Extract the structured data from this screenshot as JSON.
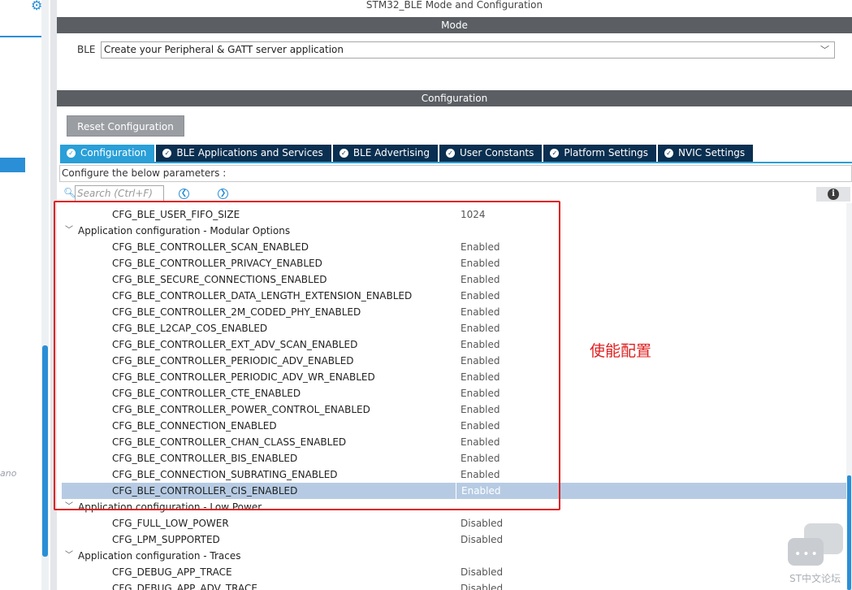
{
  "window_title": "STM32_BLE Mode and Configuration",
  "left_panel": {
    "ghost_text": "ano"
  },
  "mode_bar": {
    "label": "Mode"
  },
  "ble": {
    "label": "BLE",
    "selected": "Create your Peripheral & GATT server application"
  },
  "config_bar": {
    "label": "Configuration"
  },
  "reset_button": {
    "label": "Reset Configuration"
  },
  "tabs": [
    {
      "label": "Configuration",
      "active": true
    },
    {
      "label": "BLE Applications and Services",
      "active": false
    },
    {
      "label": "BLE Advertising",
      "active": false
    },
    {
      "label": "User Constants",
      "active": false
    },
    {
      "label": "Platform Settings",
      "active": false
    },
    {
      "label": "NVIC Settings",
      "active": false
    }
  ],
  "param_header": "Configure the below parameters :",
  "search": {
    "placeholder": "Search (Ctrl+F)"
  },
  "tree": [
    {
      "kind": "param",
      "name": "CFG_BLE_USER_FIFO_SIZE",
      "value": "1024"
    },
    {
      "kind": "group",
      "name": "Application configuration -  Modular Options"
    },
    {
      "kind": "param",
      "name": "CFG_BLE_CONTROLLER_SCAN_ENABLED",
      "value": "Enabled"
    },
    {
      "kind": "param",
      "name": "CFG_BLE_CONTROLLER_PRIVACY_ENABLED",
      "value": "Enabled"
    },
    {
      "kind": "param",
      "name": "CFG_BLE_SECURE_CONNECTIONS_ENABLED",
      "value": "Enabled"
    },
    {
      "kind": "param",
      "name": "CFG_BLE_CONTROLLER_DATA_LENGTH_EXTENSION_ENABLED",
      "value": "Enabled"
    },
    {
      "kind": "param",
      "name": "CFG_BLE_CONTROLLER_2M_CODED_PHY_ENABLED",
      "value": "Enabled"
    },
    {
      "kind": "param",
      "name": "CFG_BLE_L2CAP_COS_ENABLED",
      "value": "Enabled"
    },
    {
      "kind": "param",
      "name": "CFG_BLE_CONTROLLER_EXT_ADV_SCAN_ENABLED",
      "value": "Enabled"
    },
    {
      "kind": "param",
      "name": "CFG_BLE_CONTROLLER_PERIODIC_ADV_ENABLED",
      "value": "Enabled"
    },
    {
      "kind": "param",
      "name": "CFG_BLE_CONTROLLER_PERIODIC_ADV_WR_ENABLED",
      "value": "Enabled"
    },
    {
      "kind": "param",
      "name": "CFG_BLE_CONTROLLER_CTE_ENABLED",
      "value": "Enabled"
    },
    {
      "kind": "param",
      "name": "CFG_BLE_CONTROLLER_POWER_CONTROL_ENABLED",
      "value": "Enabled"
    },
    {
      "kind": "param",
      "name": "CFG_BLE_CONNECTION_ENABLED",
      "value": "Enabled"
    },
    {
      "kind": "param",
      "name": "CFG_BLE_CONTROLLER_CHAN_CLASS_ENABLED",
      "value": "Enabled"
    },
    {
      "kind": "param",
      "name": "CFG_BLE_CONTROLLER_BIS_ENABLED",
      "value": "Enabled"
    },
    {
      "kind": "param",
      "name": "CFG_BLE_CONNECTION_SUBRATING_ENABLED",
      "value": "Enabled"
    },
    {
      "kind": "param",
      "name": "CFG_BLE_CONTROLLER_CIS_ENABLED",
      "value": "Enabled",
      "selected": true
    },
    {
      "kind": "group",
      "name": "Application configuration - Low Power"
    },
    {
      "kind": "param",
      "name": "CFG_FULL_LOW_POWER",
      "value": "Disabled"
    },
    {
      "kind": "param",
      "name": "CFG_LPM_SUPPORTED",
      "value": "Disabled"
    },
    {
      "kind": "group",
      "name": "Application configuration - Traces"
    },
    {
      "kind": "param",
      "name": "CFG_DEBUG_APP_TRACE",
      "value": "Disabled"
    },
    {
      "kind": "param",
      "name": "CFG_DEBUG_APP_ADV_TRACE",
      "value": "Disabled"
    }
  ],
  "annotation": {
    "note": "使能配置",
    "color": "#e02020"
  },
  "watermark": {
    "text": "ST中文论坛"
  },
  "icons": {
    "gear": "gear-icon",
    "search": "search-icon",
    "prev": "chevron-left-icon",
    "next": "chevron-right-icon",
    "info": "info-icon",
    "check": "check-circle-icon",
    "expand": "chevron-down-icon"
  },
  "colors": {
    "accent": "#2a9fd8",
    "tab_inactive": "#0a2f50",
    "bar": "#5b5f64",
    "selection": "#b6cbe3"
  }
}
